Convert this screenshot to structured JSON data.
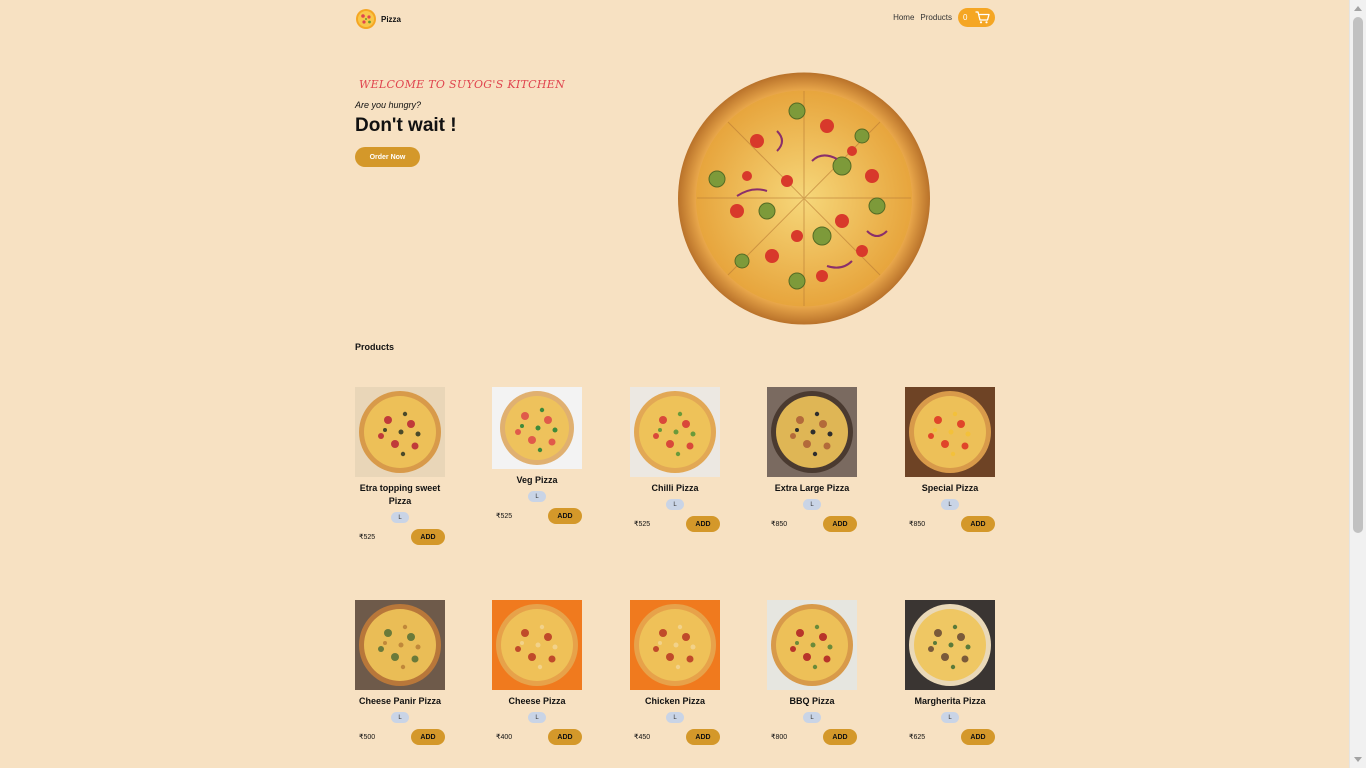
{
  "nav": {
    "brand": "Pizza",
    "links": [
      "Home",
      "Products"
    ],
    "cart_count": "0"
  },
  "hero": {
    "welcome": "WELCOME TO SUYOG'S KITCHEN",
    "question": "Are you hungry?",
    "headline": "Don't wait !",
    "cta": "Order Now"
  },
  "products_title": "Products",
  "products": [
    {
      "name": "Etra topping sweet Pizza",
      "size": "L",
      "price": "₹525",
      "add": "ADD"
    },
    {
      "name": "Veg Pizza",
      "size": "L",
      "price": "₹525",
      "add": "ADD"
    },
    {
      "name": "Chilli Pizza",
      "size": "L",
      "price": "₹525",
      "add": "ADD"
    },
    {
      "name": "Extra Large Pizza",
      "size": "L",
      "price": "₹850",
      "add": "ADD"
    },
    {
      "name": "Special Pizza",
      "size": "L",
      "price": "₹850",
      "add": "ADD"
    },
    {
      "name": "Cheese Panir Pizza",
      "size": "L",
      "price": "₹500",
      "add": "ADD"
    },
    {
      "name": "Cheese Pizza",
      "size": "L",
      "price": "₹400",
      "add": "ADD"
    },
    {
      "name": "Chicken Pizza",
      "size": "L",
      "price": "₹450",
      "add": "ADD"
    },
    {
      "name": "BBQ Pizza",
      "size": "L",
      "price": "₹800",
      "add": "ADD"
    },
    {
      "name": "Margherita Pizza",
      "size": "L",
      "price": "₹625",
      "add": "ADD"
    }
  ],
  "colors": {
    "background": "#f7e1c2",
    "accent": "#d4982a",
    "cart": "#f5a623",
    "welcome": "#e0454f"
  }
}
